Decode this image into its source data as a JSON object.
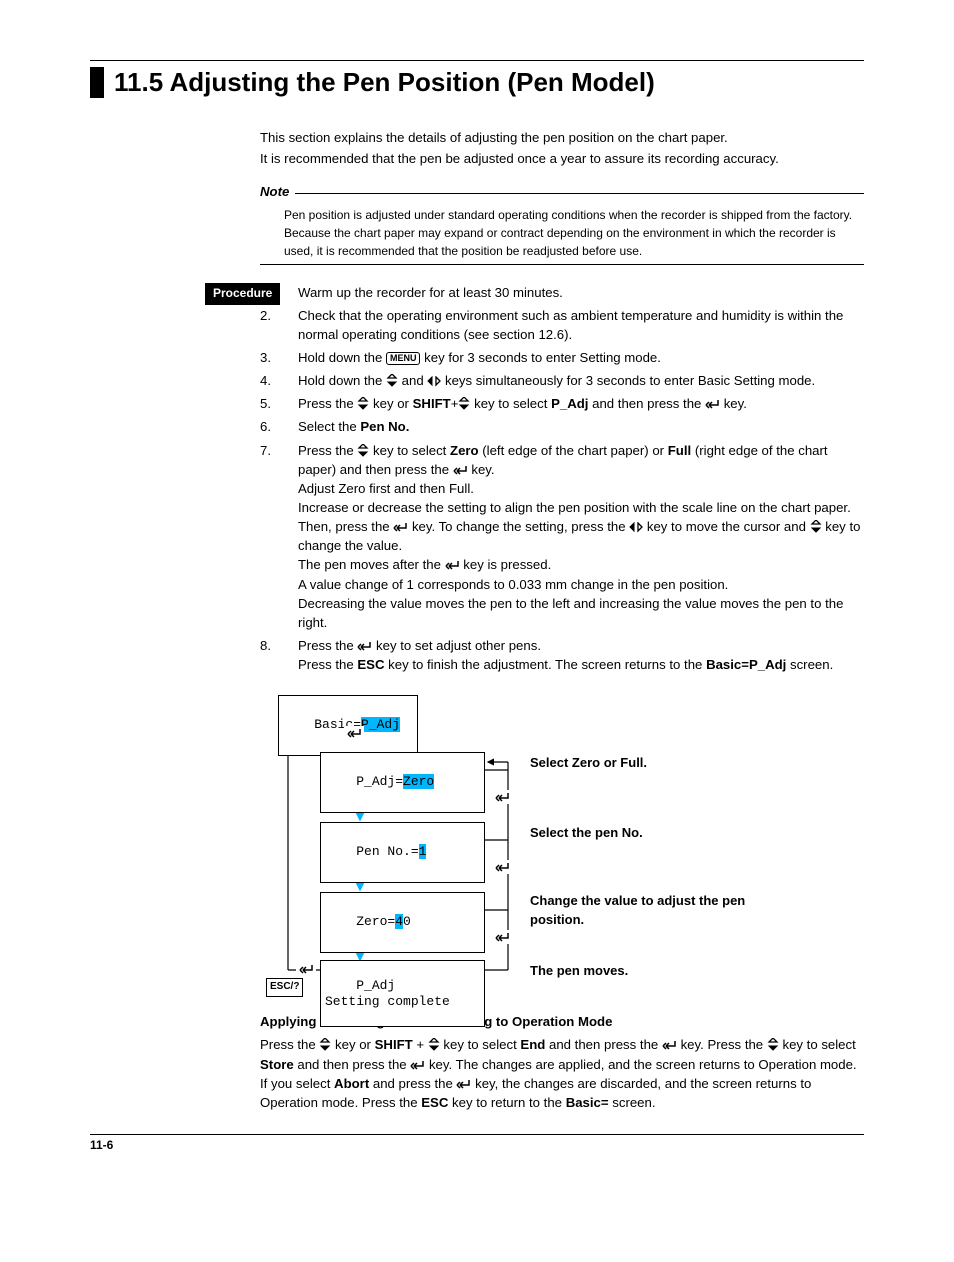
{
  "section": {
    "number": "11.5",
    "title": "Adjusting the Pen Position (Pen Model)"
  },
  "intro": {
    "line1": "This section explains the details of adjusting the pen position on the chart paper.",
    "line2": "It is recommended that the pen be adjusted once a year to assure its recording accuracy."
  },
  "note": {
    "label": "Note",
    "body": "Pen position is adjusted under standard operating conditions when the recorder is shipped from the factory.  Because the chart paper may expand or contract depending on the environment in which the recorder is used, it is recommended that the position be readjusted before use."
  },
  "procedure": {
    "label": "Procedure",
    "steps": {
      "s1": "Warm up the recorder for at least 30 minutes.",
      "s2": "Check that the operating environment such as ambient temperature and humidity is within the normal operating conditions (see section 12.6).",
      "s3a": "Hold down the ",
      "s3_key": "MENU",
      "s3b": " key for 3 seconds to enter Setting mode.",
      "s4a": "Hold down the ",
      "s4b": " and ",
      "s4c": " keys simultaneously for 3 seconds to enter Basic Setting mode.",
      "s5a": "Press the ",
      "s5b": " key or ",
      "s5_shift": "SHIFT",
      "s5c": "+",
      "s5d": " key to select ",
      "s5_padj": "P_Adj",
      "s5e": " and then press the ",
      "s5f": " key.",
      "s6a": "Select the ",
      "s6_penno": "Pen No.",
      "s7a": "Press the ",
      "s7b": " key to select ",
      "s7_zero": "Zero",
      "s7c": " (left edge of the chart paper) or ",
      "s7_full": "Full",
      "s7d": " (right edge of the chart paper) and then press the ",
      "s7e": " key.",
      "s7f": "Adjust Zero first and then Full.",
      "s7g": "Increase or decrease the setting to align the pen position with the scale line on the chart paper.  Then, press the ",
      "s7h": " key.  To change the setting, press the ",
      "s7i": " key to move the cursor and ",
      "s7j": " key to change the value.",
      "s7k": "The pen moves after the ",
      "s7l": " key is pressed.",
      "s7m": "A value change of 1 corresponds to 0.033 mm change in the pen position.",
      "s7n": "Decreasing the value moves the pen to the left and increasing the value moves the pen to the right.",
      "s8a": "Press the ",
      "s8b": " key to set adjust other pens.",
      "s8c": "Press the ",
      "s8_esc": "ESC",
      "s8d": " key to finish the adjustment.  The screen returns to the ",
      "s8_basic": "Basic=P_Adj",
      "s8e": " screen."
    }
  },
  "flow": {
    "f1_pre": "Basic=",
    "f1_val": "P_Adj",
    "f2_pre": "P_Adj=",
    "f2_val": "Zero",
    "f3_pre": "Pen No.=",
    "f3_val": "1",
    "f4_pre": "Zero=",
    "f4_val": "4",
    "f4_post": "0",
    "f5_a": "P_Adj",
    "f5_b": "Setting complete",
    "esc": "ESC/?",
    "lbl1": "Select Zero or Full.",
    "lbl2": "Select the pen No.",
    "lbl3": "Change the value to adjust the pen position.",
    "lbl4": "The pen moves."
  },
  "apply": {
    "title": "Applying the Changes and Returning to Operation Mode",
    "t1": "Press the ",
    "t2": " key or ",
    "shift": "SHIFT",
    "t3": " + ",
    "t4": " key to select ",
    "end": "End",
    "t5": " and then press the ",
    "t6": " key.  Press the ",
    "t7": " key to select ",
    "store": "Store",
    "t8": " and then press the ",
    "t9": " key.  The changes are applied, and the screen returns to Operation mode.  If you select ",
    "abort": "Abort",
    "t10": " and press the ",
    "t11": " key, the changes are discarded, and the screen returns to Operation mode.  Press the ",
    "esc": "ESC",
    "t12": " key to return to the ",
    "basic": "Basic=",
    "t13": " screen."
  },
  "footer": {
    "page": "11-6"
  },
  "icons": {
    "updown": "updown",
    "leftright": "leftright",
    "enter": "enter"
  }
}
